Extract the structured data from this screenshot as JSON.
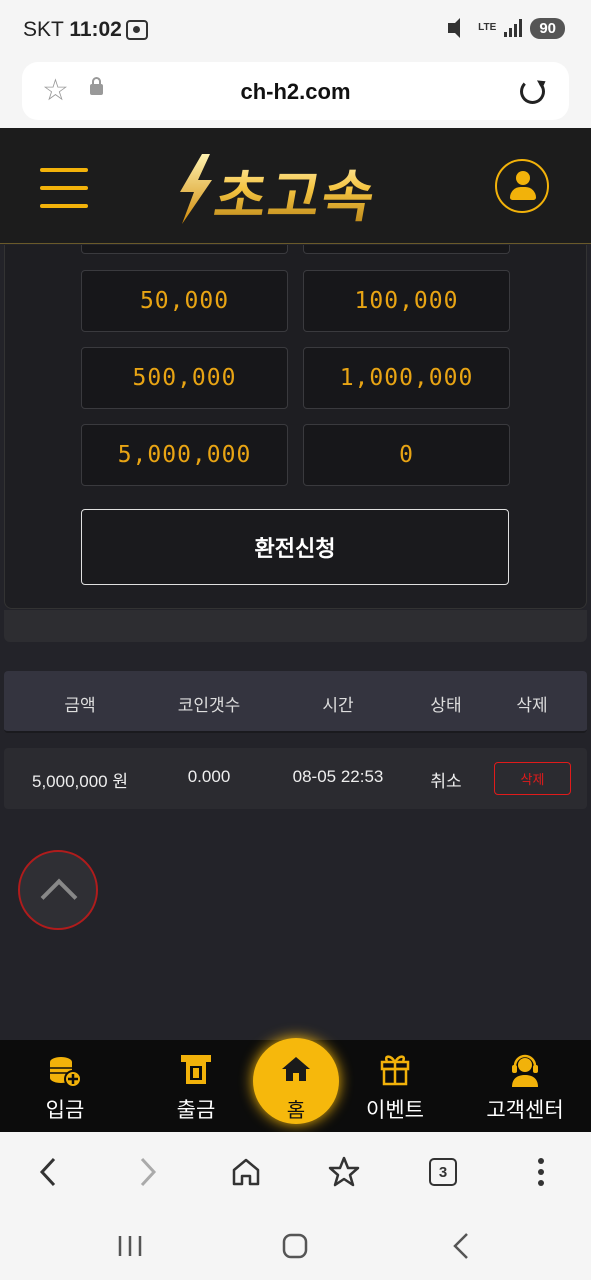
{
  "status_bar": {
    "carrier": "SKT",
    "time": "11:02",
    "network": "LTE",
    "battery": "90"
  },
  "browser": {
    "url": "ch-h2.com",
    "tab_count": "3"
  },
  "header": {
    "logo_text": "초고속"
  },
  "amounts": {
    "row0": [
      "",
      ""
    ],
    "row1": [
      "50,000",
      "100,000"
    ],
    "row2": [
      "500,000",
      "1,000,000"
    ],
    "row3": [
      "5,000,000",
      "0"
    ]
  },
  "submit_label": "환전신청",
  "table": {
    "headers": [
      "금액",
      "코인갯수",
      "시간",
      "상태",
      "삭제"
    ],
    "rows": [
      {
        "amount": "5,000,000 원",
        "coins": "0.000",
        "time": "08-05 22:53",
        "status": "취소",
        "delete": "삭제"
      }
    ]
  },
  "bottom_nav": {
    "deposit": "입금",
    "withdraw": "출금",
    "home": "홈",
    "event": "이벤트",
    "support": "고객센터"
  },
  "colors": {
    "accent": "#f2b20a",
    "danger": "#e01b1b",
    "amount_text": "#e8a414"
  }
}
